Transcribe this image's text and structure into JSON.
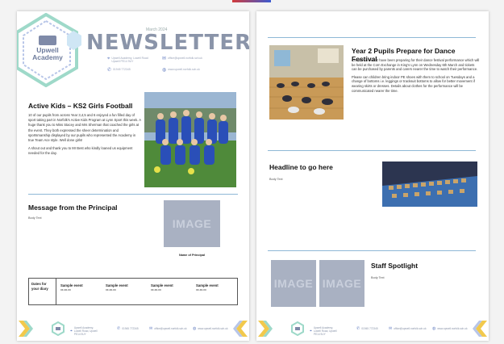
{
  "colors": {
    "accent": "#8fb8d6",
    "title": "#8a94a9",
    "placeholder": "#a9b1c2"
  },
  "newsletter": {
    "logo_text": "Upwell Academy",
    "date": "March 2024",
    "title": "NEWSLETTER",
    "contacts": [
      {
        "icon": "location-pin-icon",
        "text": "Upwell Academy, Lowell Road Upwell PE14 9UY"
      },
      {
        "icon": "mail-icon",
        "text": "office@upwell.norfolk.sch.uk"
      },
      {
        "icon": "phone-icon",
        "text": "01945 772345"
      },
      {
        "icon": "globe-icon",
        "text": "www.upwell.norfolk.sch.uk"
      }
    ]
  },
  "left": {
    "article1": {
      "heading": "Active Kids – KS2 Girls Football",
      "para1": "10 of our pupils from across Year 3,4,5 and 6 enjoyed a fun filled day of sport taking part in Norfolk's Active Kids Program at Lynn Sport this week. A huge thank you to Miss Stacey and Mrs Sherman that coached the girls at the event. They both expressed the sheer determination and sportsmanship displayed by our pupils who represented the Academy in true Team Ace style. Well done girls!",
      "para2": "A shout out and thank you to Mr Best who kindly loaned us equipment needed for the day."
    },
    "principal": {
      "heading": "Message from the Principal",
      "body": "Body Text",
      "image_label": "IMAGE",
      "caption": "Name of Principal"
    },
    "diary": {
      "label": "Dates for your diary",
      "events": [
        {
          "title": "Sample event",
          "date": "xx.xx.xx"
        },
        {
          "title": "Sample event",
          "date": "xx.xx.xx"
        },
        {
          "title": "Sample event",
          "date": "xx.xx.xx"
        },
        {
          "title": "Sample event",
          "date": "xx.xx.xx"
        }
      ]
    }
  },
  "right": {
    "article": {
      "heading": "Year 2 Pupils Prepare for Dance Festival",
      "para1": "Children in Year 2 have been preparing for their dance festival performance which will be held at the Corn Exchange in King's Lynn on Wednesday 6th March and tickets can be purchased by parents and carers nearer the time to watch their performance.",
      "para2": "Please can children bring indoor PE shoes with them to school on Tuesdays and a change of bottoms i.e. leggings or tracksuit bottoms to allow for better movement if wearing skirts or dresses. Details about clothes for the performance will be communicated nearer the time."
    },
    "headline": {
      "heading": "Headline to go here",
      "body": "Body Text"
    },
    "staff": {
      "heading": "Staff Spotlight",
      "body": "Body Text",
      "image_label_1": "IMAGE",
      "image_label_2": "IMAGE"
    }
  },
  "footer": {
    "items": [
      {
        "icon": "location-pin-icon",
        "text": "Upwell Academy, Lowell Road, Upwell PE14 9UY"
      },
      {
        "icon": "phone-icon",
        "text": "01945 772345"
      },
      {
        "icon": "mail-icon",
        "text": "office@upwell.norfolk.sch.uk"
      },
      {
        "icon": "globe-icon",
        "text": "www.upwell.norfolk.sch.uk"
      }
    ]
  }
}
